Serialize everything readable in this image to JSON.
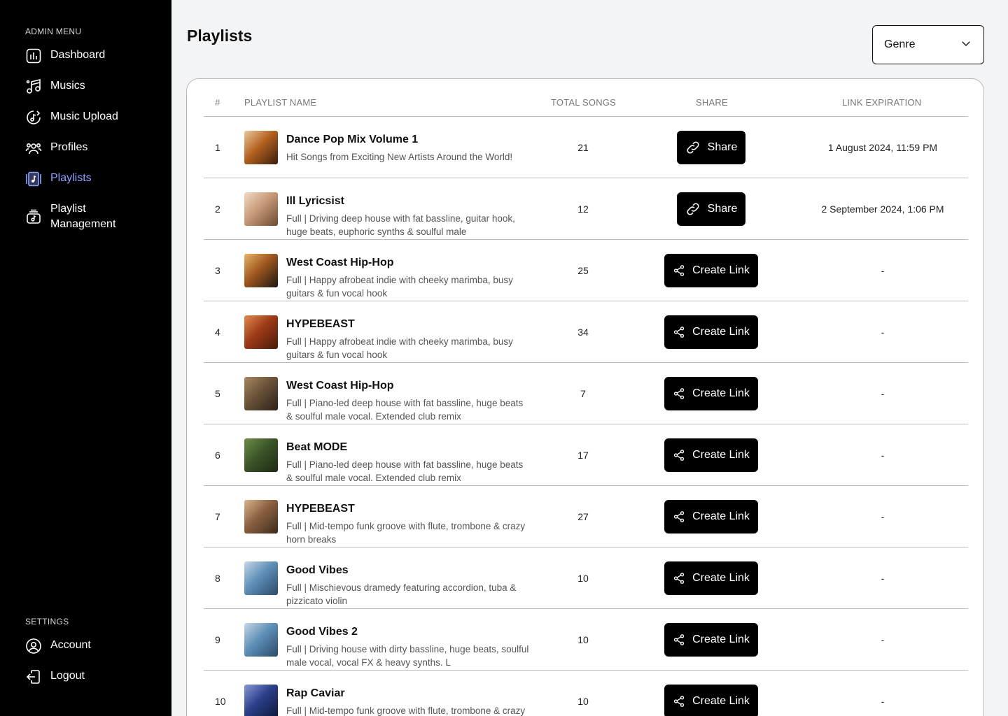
{
  "sidebar": {
    "admin_label": "ADMIN MENU",
    "settings_label": "SETTINGS",
    "items": [
      {
        "label": "Dashboard",
        "icon": "dashboard-icon"
      },
      {
        "label": "Musics",
        "icon": "music-notes-icon"
      },
      {
        "label": "Music Upload",
        "icon": "music-upload-icon"
      },
      {
        "label": "Profiles",
        "icon": "profiles-icon"
      },
      {
        "label": "Playlists",
        "icon": "playlists-icon",
        "active": true
      },
      {
        "label": "Playlist Management",
        "icon": "playlist-management-icon"
      }
    ],
    "settings": [
      {
        "label": "Account",
        "icon": "account-icon"
      },
      {
        "label": "Logout",
        "icon": "logout-icon"
      }
    ],
    "active_color": "#8ea2ff"
  },
  "main": {
    "title": "Playlists",
    "genre_select": {
      "value": "Genre"
    },
    "table": {
      "headers": [
        "#",
        "PLAYLIST NAME",
        "TOTAL SONGS",
        "SHARE",
        "LINK EXPIRATION"
      ],
      "rows": [
        {
          "num": "1",
          "name": "Dance Pop Mix Volume 1",
          "desc": "Hit Songs from Exciting New Artists Around the World!",
          "songs": "21",
          "action": "Share",
          "action_icon": "link-icon",
          "expiry": "1 August 2024, 11:59 PM"
        },
        {
          "num": "2",
          "name": "Ill Lyricsist",
          "desc": "Full | Driving deep house with fat bassline, guitar hook, huge beats, euphoric synths & soulful male",
          "songs": "12",
          "action": "Share",
          "action_icon": "link-icon",
          "expiry": "2 September 2024, 1:06 PM"
        },
        {
          "num": "3",
          "name": "West Coast Hip-Hop",
          "desc": "Full | Happy afrobeat indie with cheeky marimba, busy guitars & fun vocal hook",
          "songs": "25",
          "action": "Create Link",
          "action_icon": "share-nodes-icon",
          "expiry": "-"
        },
        {
          "num": "4",
          "name": "HYPEBEAST",
          "desc": "Full | Happy afrobeat indie with cheeky marimba, busy guitars & fun vocal hook",
          "songs": "34",
          "action": "Create Link",
          "action_icon": "share-nodes-icon",
          "expiry": "-"
        },
        {
          "num": "5",
          "name": "West Coast Hip-Hop",
          "desc": "Full | Piano-led deep house with fat bassline, huge beats & soulful male vocal. Extended club remix",
          "songs": "7",
          "action": "Create Link",
          "action_icon": "share-nodes-icon",
          "expiry": "-"
        },
        {
          "num": "6",
          "name": "Beat MODE",
          "desc": "Full | Piano-led deep house with fat bassline, huge beats & soulful male vocal. Extended club remix",
          "songs": "17",
          "action": "Create Link",
          "action_icon": "share-nodes-icon",
          "expiry": "-"
        },
        {
          "num": "7",
          "name": "HYPEBEAST",
          "desc": "Full | Mid-tempo funk groove with flute, trombone & crazy horn breaks",
          "songs": "27",
          "action": "Create Link",
          "action_icon": "share-nodes-icon",
          "expiry": "-"
        },
        {
          "num": "8",
          "name": "Good Vibes",
          "desc": "Full | Mischievous dramedy featuring accordion, tuba & pizzicato violin",
          "songs": "10",
          "action": "Create Link",
          "action_icon": "share-nodes-icon",
          "expiry": "-"
        },
        {
          "num": "9",
          "name": "Good Vibes 2",
          "desc": "Full | Driving house with dirty bassline, huge beats, soulful male vocal, vocal FX & heavy synths. L",
          "songs": "10",
          "action": "Create Link",
          "action_icon": "share-nodes-icon",
          "expiry": "-"
        },
        {
          "num": "10",
          "name": "Rap Caviar",
          "desc": "Full | Mid-tempo funk groove with flute, trombone & crazy horn breaks",
          "songs": "10",
          "action": "Create Link",
          "action_icon": "share-nodes-icon",
          "expiry": "-"
        }
      ]
    }
  }
}
